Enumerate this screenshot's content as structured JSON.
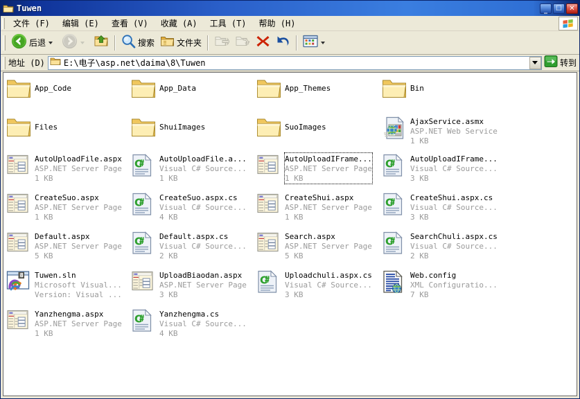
{
  "window": {
    "title": "Tuwen",
    "titlebar_icon": "folder-icon",
    "buttons": {
      "minimize": "_",
      "maximize": "☐",
      "close": "✕"
    }
  },
  "menu": {
    "items": [
      {
        "label": "文件 (F)",
        "name": "menu-file"
      },
      {
        "label": "编辑 (E)",
        "name": "menu-edit"
      },
      {
        "label": "查看 (V)",
        "name": "menu-view"
      },
      {
        "label": "收藏 (A)",
        "name": "menu-favorites"
      },
      {
        "label": "工具 (T)",
        "name": "menu-tools"
      },
      {
        "label": "帮助 (H)",
        "name": "menu-help"
      }
    ]
  },
  "toolbar": {
    "back_label": "后退",
    "forward_label": "",
    "up_label": "",
    "search_label": "搜索",
    "folders_label": "文件夹",
    "move_label": "",
    "copy_label": "",
    "delete_label": "",
    "undo_label": "",
    "views_label": ""
  },
  "address": {
    "label": "地址 (D)",
    "value": "E:\\电子\\asp.net\\daima\\8\\Tuwen",
    "placeholder": "",
    "go_label": "转到"
  },
  "files": [
    {
      "name": "App_Code",
      "type": "",
      "size": "",
      "icon": "folder",
      "focused": false
    },
    {
      "name": "App_Data",
      "type": "",
      "size": "",
      "icon": "folder",
      "focused": false
    },
    {
      "name": "App_Themes",
      "type": "",
      "size": "",
      "icon": "folder",
      "focused": false
    },
    {
      "name": "Bin",
      "type": "",
      "size": "",
      "icon": "folder",
      "focused": false
    },
    {
      "name": "Files",
      "type": "",
      "size": "",
      "icon": "folder",
      "focused": false
    },
    {
      "name": "ShuiImages",
      "type": "",
      "size": "",
      "icon": "folder",
      "focused": false
    },
    {
      "name": "SuoImages",
      "type": "",
      "size": "",
      "icon": "folder",
      "focused": false
    },
    {
      "name": "AjaxService.asmx",
      "type": "ASP.NET Web Service",
      "size": "1 KB",
      "icon": "asmx",
      "focused": false
    },
    {
      "name": "AutoUploadFile.aspx",
      "type": "ASP.NET Server Page",
      "size": "1 KB",
      "icon": "aspx",
      "focused": false
    },
    {
      "name": "AutoUploadFile.a...",
      "type": "Visual C# Source...",
      "size": "1 KB",
      "icon": "cs",
      "focused": false
    },
    {
      "name": "AutoUploadIFrame...",
      "type": "ASP.NET Server Page",
      "size": "1 KB",
      "icon": "aspx",
      "focused": true
    },
    {
      "name": "AutoUploadIFrame...",
      "type": "Visual C# Source...",
      "size": "3 KB",
      "icon": "cs",
      "focused": false
    },
    {
      "name": "CreateSuo.aspx",
      "type": "ASP.NET Server Page",
      "size": "1 KB",
      "icon": "aspx",
      "focused": false
    },
    {
      "name": "CreateSuo.aspx.cs",
      "type": "Visual C# Source...",
      "size": "4 KB",
      "icon": "cs",
      "focused": false
    },
    {
      "name": "CreateShui.aspx",
      "type": "ASP.NET Server Page",
      "size": "1 KB",
      "icon": "aspx",
      "focused": false
    },
    {
      "name": "CreateShui.aspx.cs",
      "type": "Visual C# Source...",
      "size": "3 KB",
      "icon": "cs",
      "focused": false
    },
    {
      "name": "Default.aspx",
      "type": "ASP.NET Server Page",
      "size": "5 KB",
      "icon": "aspx",
      "focused": false
    },
    {
      "name": "Default.aspx.cs",
      "type": "Visual C# Source...",
      "size": "2 KB",
      "icon": "cs",
      "focused": false
    },
    {
      "name": "Search.aspx",
      "type": "ASP.NET Server Page",
      "size": "5 KB",
      "icon": "aspx",
      "focused": false
    },
    {
      "name": "SearchChuli.aspx.cs",
      "type": "Visual C# Source...",
      "size": "2 KB",
      "icon": "cs",
      "focused": false
    },
    {
      "name": "Tuwen.sln",
      "type": "Microsoft Visual...",
      "size": "Version: Visual ...",
      "icon": "sln",
      "focused": false
    },
    {
      "name": "UploadBiaodan.aspx",
      "type": "ASP.NET Server Page",
      "size": "3 KB",
      "icon": "aspx",
      "focused": false
    },
    {
      "name": "Uploadchuli.aspx.cs",
      "type": "Visual C# Source...",
      "size": "3 KB",
      "icon": "cs",
      "focused": false
    },
    {
      "name": "Web.config",
      "type": "XML Configuratio...",
      "size": "7 KB",
      "icon": "xml",
      "focused": false
    },
    {
      "name": "Yanzhengma.aspx",
      "type": "ASP.NET Server Page",
      "size": "1 KB",
      "icon": "aspx",
      "focused": false
    },
    {
      "name": "Yanzhengma.cs",
      "type": "Visual C# Source...",
      "size": "4 KB",
      "icon": "cs",
      "focused": false
    }
  ],
  "colors": {
    "titlebar_blue": "#0a246a",
    "folder_yellow": "#fde9a9",
    "cs_green": "#2ea02e",
    "delete_red": "#cc2200",
    "undo_blue": "#1a4fa0",
    "go_green": "#2f9e2f",
    "desktop_gray": "#ece9d8"
  }
}
